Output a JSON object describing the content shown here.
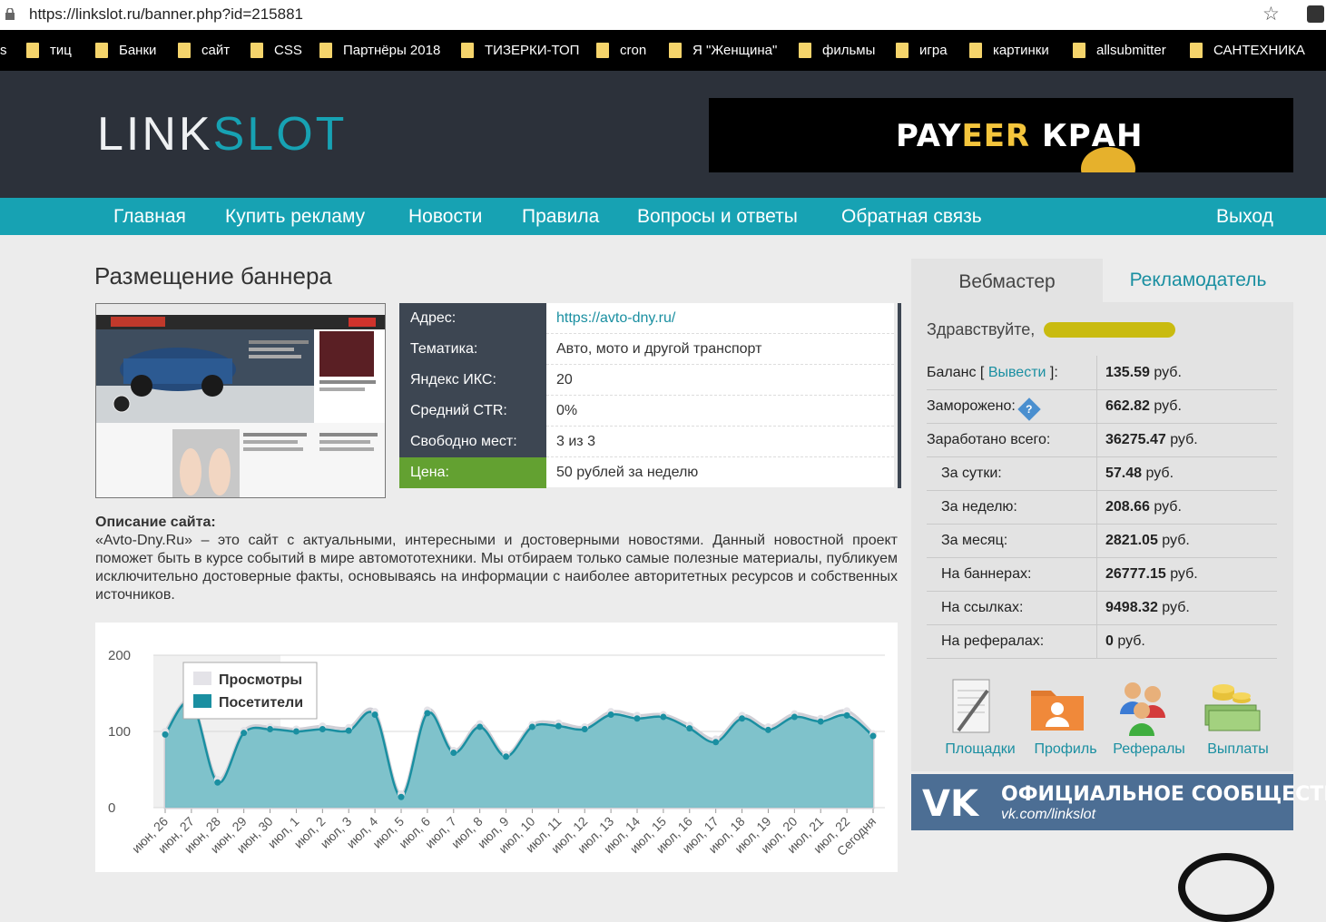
{
  "browser": {
    "url": "https://linkslot.ru/banner.php?id=215881",
    "bookmarks": [
      "s",
      "тиц",
      "Банки",
      "сайт",
      "CSS",
      "Партнёры 2018",
      "ТИЗЕРКИ-ТОП",
      "cron",
      "Я \"Женщина\"",
      "фильмы",
      "игра",
      "картинки",
      "allsubmitter",
      "САНТЕХНИКА"
    ]
  },
  "header": {
    "logo_part1": "LINK",
    "logo_part2": "SLOT",
    "banner_text_1": "PAY",
    "banner_text_2": "EER",
    "banner_text_3": " КРАН"
  },
  "nav": {
    "items": [
      "Главная",
      "Купить рекламу",
      "Новости",
      "Правила",
      "Вопросы и ответы",
      "Обратная связь"
    ],
    "logout": "Выход"
  },
  "main": {
    "title": "Размещение баннера",
    "info": [
      {
        "label": "Адрес:",
        "value": "https://avto-dny.ru/"
      },
      {
        "label": "Тематика:",
        "value": "Авто, мото и другой транспорт"
      },
      {
        "label": "Яндекс ИКС:",
        "value": "20"
      },
      {
        "label": "Средний CTR:",
        "value": "0%"
      },
      {
        "label": "Свободно мест:",
        "value": "3 из 3"
      },
      {
        "label": "Цена:",
        "value": "50 рублей за неделю"
      }
    ],
    "description_title": "Описание сайта:",
    "description": "«Avto-Dny.Ru» – это сайт с актуальными, интересными и достоверными новостями. Данный новостной проект поможет быть в курсе событий в мире автомототехники. Мы отбираем только самые полезные материалы, публикуем исключительно достоверные факты, основываясь на информации с наиболее авторитетных ресурсов и собственных источников."
  },
  "chart_data": {
    "type": "area",
    "categories": [
      "июн, 26",
      "июн, 27",
      "июн, 28",
      "июн, 29",
      "июн, 30",
      "июл, 1",
      "июл, 2",
      "июл, 3",
      "июл, 4",
      "июл, 5",
      "июл, 6",
      "июл, 7",
      "июл, 8",
      "июл, 9",
      "июл, 10",
      "июл, 11",
      "июл, 12",
      "июл, 13",
      "июл, 14",
      "июл, 15",
      "июл, 16",
      "июл, 17",
      "июл, 18",
      "июл, 19",
      "июл, 20",
      "июл, 21",
      "июл, 22",
      "Сегодня"
    ],
    "series": [
      {
        "name": "Просмотры",
        "color": "#e4e3e8",
        "values": [
          100,
          140,
          37,
          101,
          106,
          103,
          107,
          105,
          126,
          18,
          128,
          75,
          110,
          70,
          109,
          111,
          106,
          126,
          121,
          122,
          108,
          90,
          121,
          106,
          123,
          117,
          127,
          97
        ]
      },
      {
        "name": "Посетители",
        "color": "#1a8fa1",
        "values": [
          96,
          138,
          33,
          98,
          103,
          100,
          103,
          101,
          122,
          14,
          124,
          72,
          106,
          67,
          106,
          107,
          103,
          122,
          117,
          119,
          104,
          86,
          117,
          102,
          119,
          113,
          121,
          94
        ]
      }
    ],
    "ylim": [
      0,
      200
    ],
    "yticks": [
      "200",
      "100",
      "0"
    ],
    "legend": "top-left",
    "grid": true
  },
  "sidebar": {
    "tab_webmaster": "Вебмастер",
    "tab_advertiser": "Рекламодатель",
    "greeting": "Здравствуйте,",
    "withdraw_link": "Вывести",
    "stats": [
      {
        "label": "Баланс",
        "value": "135.59",
        "unit": "руб."
      },
      {
        "label": "Заморожено:",
        "value": "662.82",
        "unit": "руб."
      },
      {
        "label": "Заработано всего:",
        "value": "36275.47",
        "unit": "руб."
      },
      {
        "label": "За сутки:",
        "value": "57.48",
        "unit": "руб."
      },
      {
        "label": "За неделю:",
        "value": "208.66",
        "unit": "руб."
      },
      {
        "label": "За месяц:",
        "value": "2821.05",
        "unit": "руб."
      },
      {
        "label": "На баннерах:",
        "value": "26777.15",
        "unit": "руб."
      },
      {
        "label": "На ссылках:",
        "value": "9498.32",
        "unit": "руб."
      },
      {
        "label": "На рефералах:",
        "value": "0",
        "unit": "руб."
      }
    ],
    "icons": [
      {
        "label": "Площадки",
        "icon": "notepad-icon"
      },
      {
        "label": "Профиль",
        "icon": "profile-folder-icon"
      },
      {
        "label": "Рефералы",
        "icon": "users-icon"
      },
      {
        "label": "Выплаты",
        "icon": "money-icon"
      }
    ],
    "vk": {
      "logo": "VK",
      "title": "ОФИЦИАЛЬНОЕ СООБЩЕСТВО",
      "subtitle": "vk.com/linkslot"
    }
  }
}
